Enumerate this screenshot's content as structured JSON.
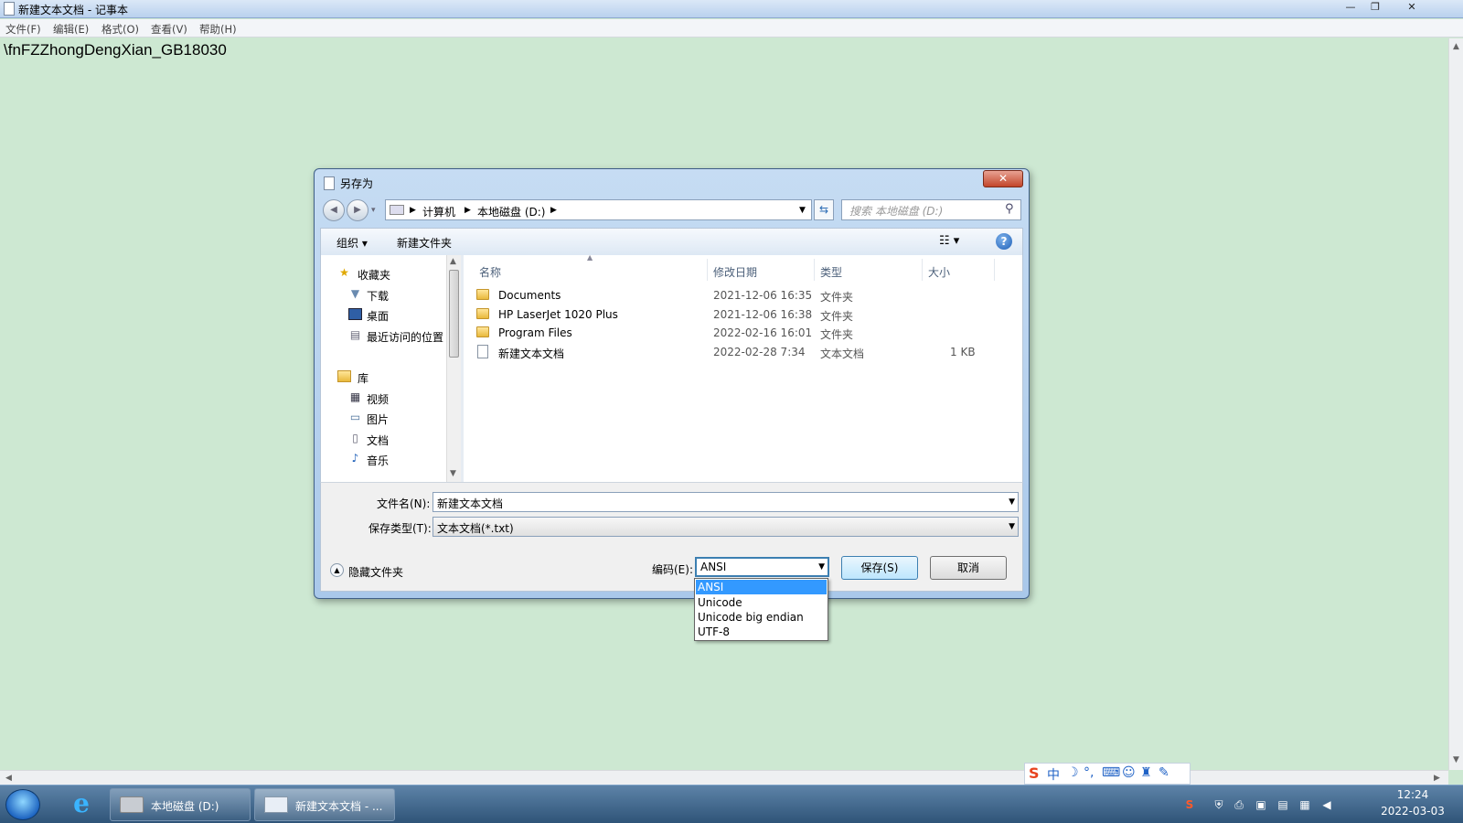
{
  "window": {
    "title": "新建文本文档 - 记事本",
    "minimize": "—",
    "restore": "❐",
    "close": "✕"
  },
  "menu": [
    "文件(F)",
    "编辑(E)",
    "格式(O)",
    "查看(V)",
    "帮助(H)"
  ],
  "editor": {
    "text": "\\fnFZZhongDengXian_GB18030"
  },
  "dialog": {
    "title": "另存为",
    "close": "✕",
    "address": {
      "segments": [
        "计算机",
        "本地磁盘 (D:)"
      ]
    },
    "search_placeholder": "搜索 本地磁盘 (D:)",
    "toolbar": {
      "organize": "组织 ▾",
      "new_folder": "新建文件夹",
      "help": "?"
    },
    "nav": {
      "favorites": "收藏夹",
      "downloads": "下载",
      "desktop": "桌面",
      "recent": "最近访问的位置",
      "libraries": "库",
      "videos": "视频",
      "pictures": "图片",
      "documents": "文档",
      "music": "音乐"
    },
    "columns": {
      "name": "名称",
      "modified": "修改日期",
      "type": "类型",
      "size": "大小"
    },
    "files": [
      {
        "name": "Documents",
        "modified": "2021-12-06 16:35",
        "type": "文件夹",
        "size": ""
      },
      {
        "name": "HP LaserJet 1020 Plus",
        "modified": "2021-12-06 16:38",
        "type": "文件夹",
        "size": ""
      },
      {
        "name": "Program Files",
        "modified": "2022-02-16 16:01",
        "type": "文件夹",
        "size": ""
      },
      {
        "name": "新建文本文档",
        "modified": "2022-02-28 7:34",
        "type": "文本文档",
        "size": "1 KB"
      }
    ],
    "filename_label": "文件名(N):",
    "filename_value": "新建文本文档",
    "filetype_label": "保存类型(T):",
    "filetype_value": "文本文档(*.txt)",
    "hide_folders": "隐藏文件夹",
    "encoding_label": "编码(E):",
    "encoding_value": "ANSI",
    "encoding_options": [
      "ANSI",
      "Unicode",
      "Unicode big endian",
      "UTF-8"
    ],
    "save": "保存(S)",
    "cancel": "取消"
  },
  "ime": {
    "logo": "S",
    "mode": "中"
  },
  "taskbar": {
    "tasks": [
      "本地磁盘 (D:)",
      "新建文本文档 - ..."
    ],
    "time": "12:24",
    "date": "2022-03-03"
  }
}
